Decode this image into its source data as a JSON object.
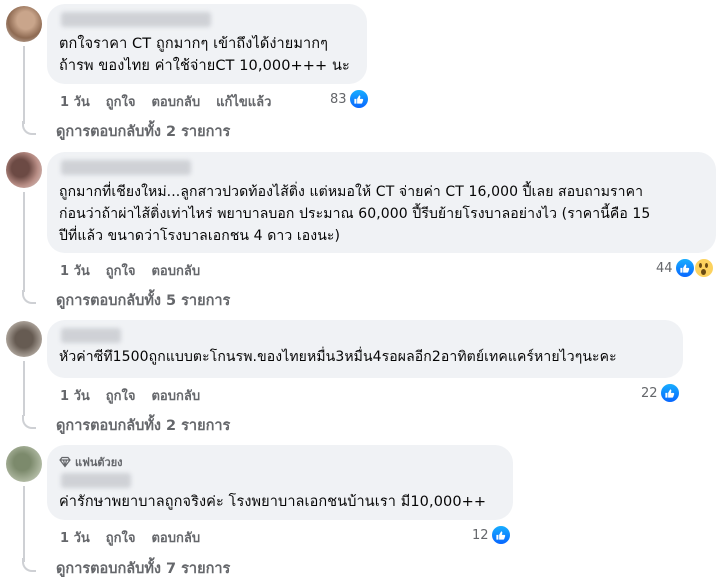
{
  "comments": [
    {
      "text": "ตกใจราคา CT ถูกมากๆ เข้าถึงได้ง่ายมากๆ\nถ้ารพ ของไทย ค่าใช้จ่ายCT 10,000+++ นะ",
      "time": "1 วัน",
      "like_label": "ถูกใจ",
      "reply_label": "ตอบกลับ",
      "edited_label": "แก้ไขแล้ว",
      "reaction_count": "83",
      "reactions": [
        "like-icon"
      ],
      "view_replies": "ดูการตอบกลับทั้ง 2 รายการ"
    },
    {
      "text": "ถูกมากที่เชียงใหม่...ลูกสาวปวดท้องไส้ติ่ง แต่หมอให้ CT จ่ายค่า CT 16,000 ปี้เลย สอบถามราคา\nก่อนว่าถ้าผ่าไส้ติ่งเท่าไหร่ พยาบาลบอก ประมาณ 60,000 ปี้รีบย้ายโรงบาลอย่างไว (ราคานี้คือ 15\nปีที่แล้ว ขนาดว่าโรงบาลเอกชน 4 ดาว เองนะ)",
      "time": "1 วัน",
      "like_label": "ถูกใจ",
      "reply_label": "ตอบกลับ",
      "reaction_count": "44",
      "reactions": [
        "like-icon",
        "wow-icon"
      ],
      "view_replies": "ดูการตอบกลับทั้ง 5 รายการ"
    },
    {
      "text": "หัวค่าซีทึ1500ถูกแบบตะโกนรพ.ของไทยหมื่น3หมื่น4รอผลอีก2อาทิตย์เทคแคร์หายไวๆนะคะ",
      "time": "1 วัน",
      "like_label": "ถูกใจ",
      "reply_label": "ตอบกลับ",
      "reaction_count": "22",
      "reactions": [
        "like-icon"
      ],
      "view_replies": "ดูการตอบกลับทั้ง 2 รายการ"
    },
    {
      "badge": "แฟนตัวยง",
      "text": "ค่ารักษาพยาบาลถูกจริงค่ะ โรงพยาบาลเอกชนบ้านเรา มี10,000++",
      "time": "1 วัน",
      "like_label": "ถูกใจ",
      "reply_label": "ตอบกลับ",
      "reaction_count": "12",
      "reactions": [
        "like-icon"
      ],
      "view_replies": "ดูการตอบกลับทั้ง 7 รายการ"
    }
  ],
  "colors": {
    "bubble": "#f0f2f5",
    "meta_text": "#65676b",
    "like_blue": "#0866ff"
  }
}
